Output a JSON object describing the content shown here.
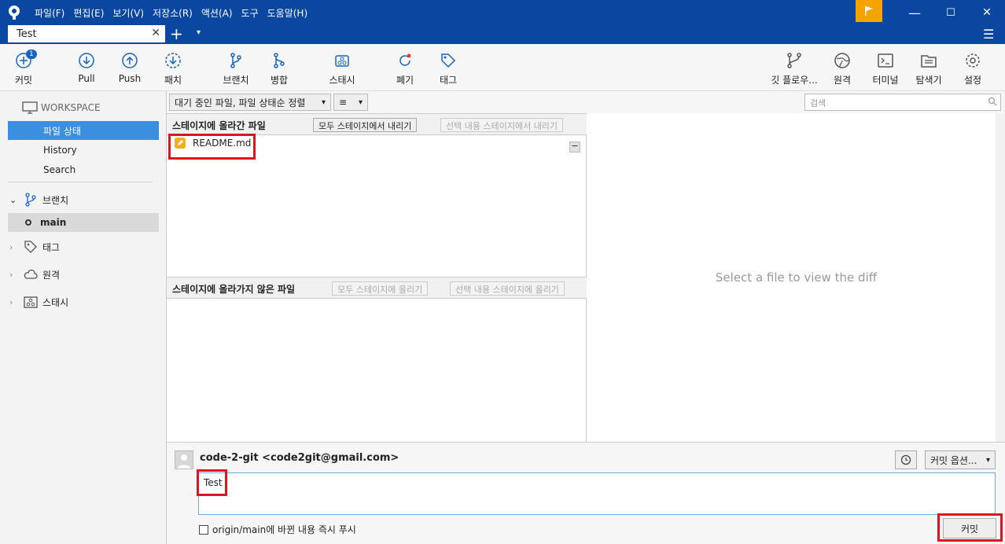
{
  "window": {
    "minimize": "—",
    "maximize": "☐",
    "close": "✕"
  },
  "menu": [
    "파일(F)",
    "편집(E)",
    "보기(V)",
    "저장소(R)",
    "액션(A)",
    "도구",
    "도움말(H)"
  ],
  "tab": {
    "title": "Test",
    "close": "✕",
    "add": "+",
    "dropdown": "▾"
  },
  "toolbar": {
    "commit": "커밋",
    "commit_badge": "1",
    "pull": "Pull",
    "push": "Push",
    "patch": "패치",
    "branch": "브랜치",
    "merge": "병합",
    "stash": "스태시",
    "discard": "폐기",
    "tag": "태그",
    "gitflow": "깃 플로우...",
    "remote": "원격",
    "terminal": "터미널",
    "explorer": "탐색기",
    "settings": "설정"
  },
  "sidebar": {
    "workspace": "WORKSPACE",
    "file_status": "파일 상태",
    "history": "History",
    "search": "Search",
    "branches": "브랜치",
    "branch_main": "main",
    "tags": "태그",
    "remotes": "원격",
    "stashes": "스태시"
  },
  "filter": {
    "sort": "대기 중인 파일, 파일 상태순 정렬",
    "view_icon": "≡",
    "search_placeholder": "검색"
  },
  "staged": {
    "title": "스테이지에 올라간 파일",
    "unstage_all": "모두 스테이지에서 내리기",
    "unstage_selected": "선택 내용 스테이지에서 내리기",
    "files": [
      "README.md"
    ],
    "minus": "−"
  },
  "unstaged": {
    "title": "스테이지에 올라가지 않은 파일",
    "stage_all": "모두 스테이지에 올리기",
    "stage_selected": "선택 내용 스테이지에 올리기"
  },
  "diff": {
    "empty_message": "Select a file to view the diff"
  },
  "commit": {
    "author": "code-2-git <code2git@gmail.com>",
    "options": "커밋 옵션...",
    "message": "Test",
    "push_label": "origin/main에 바뀐 내용 즉시 푸시",
    "button": "커밋"
  },
  "colors": {
    "titlebar": "#0a47a0",
    "selection": "#3b8fe0",
    "highlight": "#e0141e",
    "flag": "#f5a300"
  }
}
